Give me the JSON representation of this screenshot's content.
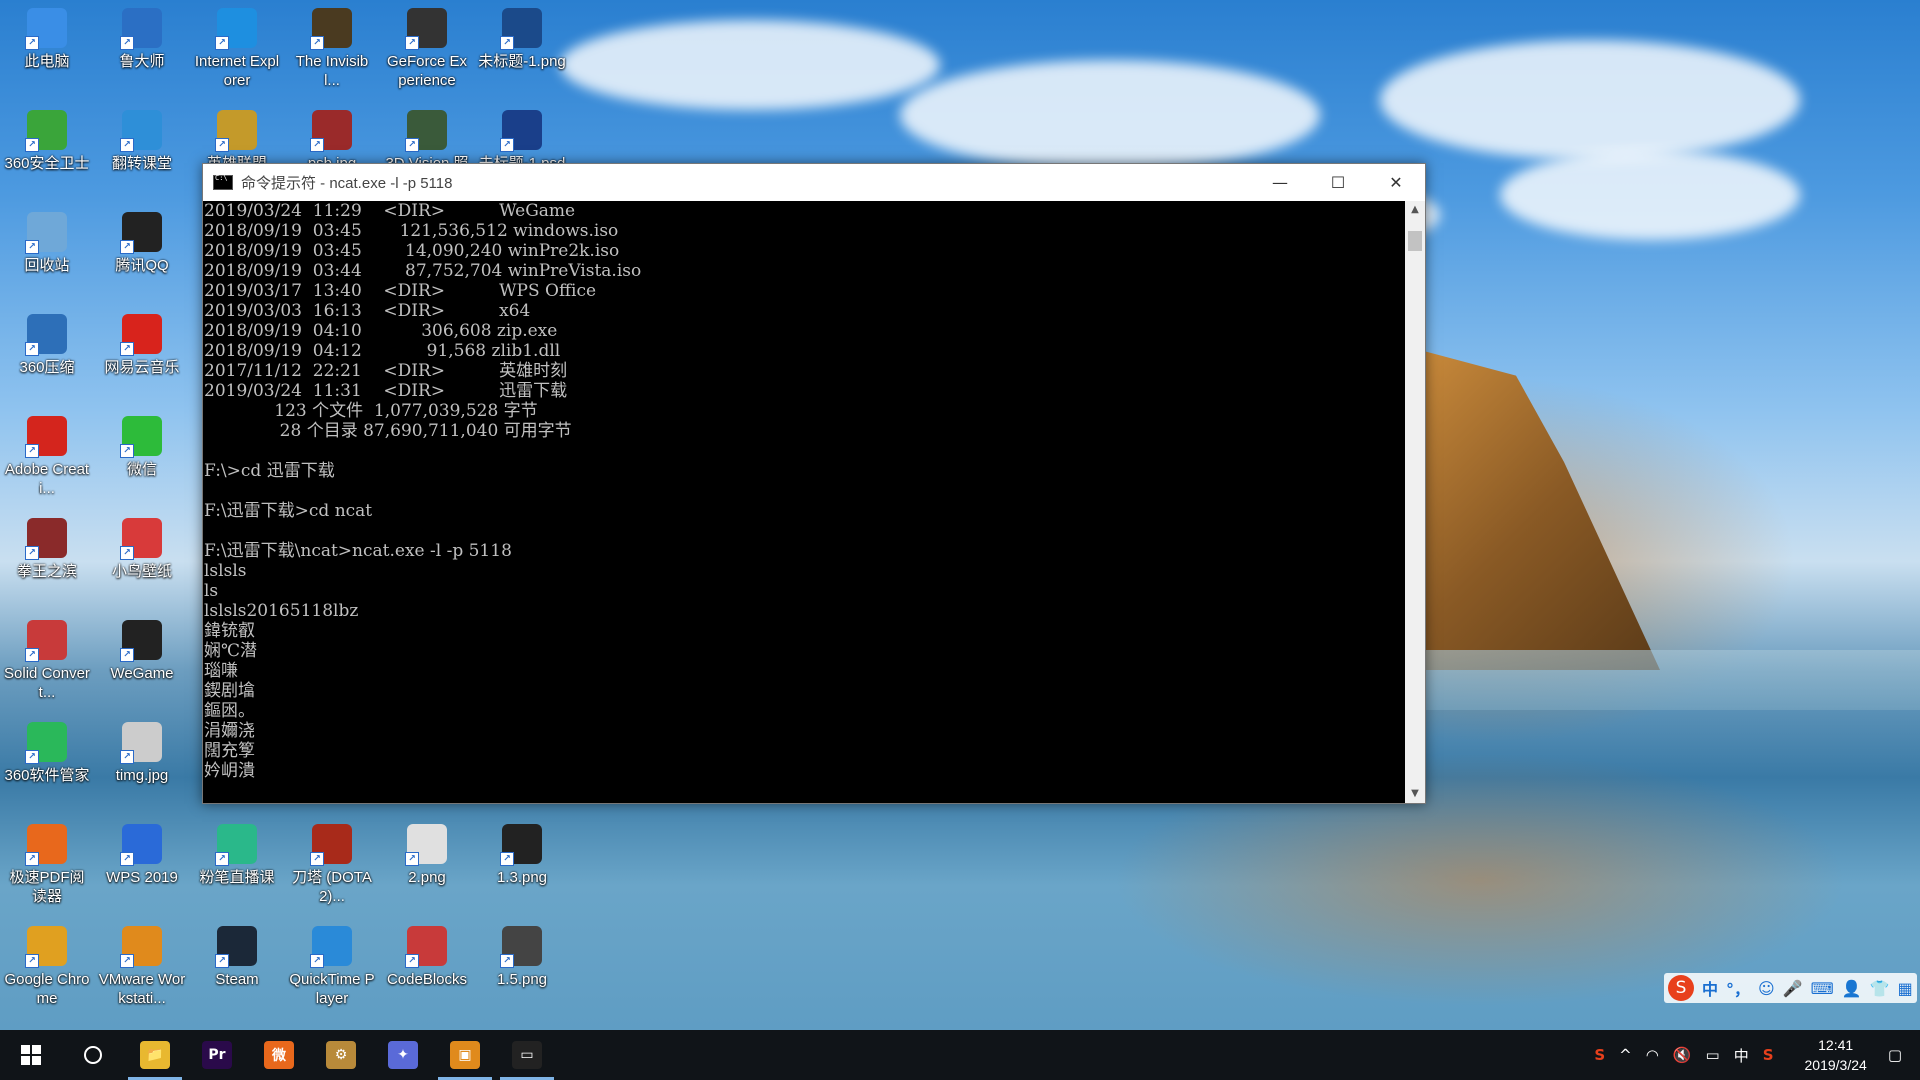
{
  "desktop": {
    "icons": [
      {
        "label": "此电脑",
        "icon": "computer-icon",
        "color": "#3a8ee6"
      },
      {
        "label": "鲁大师",
        "icon": "ludashi-icon",
        "color": "#2b6fc4"
      },
      {
        "label": "Internet Explorer",
        "icon": "ie-icon",
        "color": "#1e8fe0"
      },
      {
        "label": "The Invisibl...",
        "icon": "game-icon",
        "color": "#4a3a20"
      },
      {
        "label": "GeForce Experience",
        "icon": "geforce-icon",
        "color": "#333333"
      },
      {
        "label": "未标题-1.png",
        "icon": "image-file-icon",
        "color": "#1b4a8a"
      },
      {
        "label": "360安全卫士",
        "icon": "360-security-icon",
        "color": "#3aa53a"
      },
      {
        "label": "翻转课堂",
        "icon": "flip-class-icon",
        "color": "#2e8fd8"
      },
      {
        "label": "英雄联盟",
        "icon": "lol-icon",
        "color": "#c49a2a"
      },
      {
        "label": "psb.jpg",
        "icon": "image-file-icon",
        "color": "#9a2a2a"
      },
      {
        "label": "3D Vision 照片查看器",
        "icon": "3d-vision-icon",
        "color": "#3a5a3a"
      },
      {
        "label": "未标题-1.psd",
        "icon": "photoshop-icon",
        "color": "#1a3f8a"
      },
      {
        "label": "回收站",
        "icon": "recycle-bin-icon",
        "color": "#6fa8d8"
      },
      {
        "label": "腾讯QQ",
        "icon": "qq-icon",
        "color": "#222222"
      },
      {
        "label": "360压缩",
        "icon": "360-zip-icon",
        "color": "#2d6fb8"
      },
      {
        "label": "网易云音乐",
        "icon": "netease-music-icon",
        "color": "#d8231c"
      },
      {
        "label": "Adobe Creati...",
        "icon": "adobe-cc-icon",
        "color": "#d4251d"
      },
      {
        "label": "微信",
        "icon": "wechat-icon",
        "color": "#2dbb3a"
      },
      {
        "label": "拳王之滨",
        "icon": "game-icon",
        "color": "#8a2a2a"
      },
      {
        "label": "小鸟壁纸",
        "icon": "bird-wallpaper-icon",
        "color": "#d83a3a"
      },
      {
        "label": "Solid Convert...",
        "icon": "solid-converter-icon",
        "color": "#c83a3a"
      },
      {
        "label": "WeGame",
        "icon": "wegame-icon",
        "color": "#222222"
      },
      {
        "label": "360软件管家",
        "icon": "360-software-icon",
        "color": "#2ab85a"
      },
      {
        "label": "timg.jpg",
        "icon": "image-file-icon",
        "color": "#cccccc"
      },
      {
        "label": "极速PDF阅读器",
        "icon": "pdf-reader-icon",
        "color": "#e8681c"
      },
      {
        "label": "WPS 2019",
        "icon": "wps-icon",
        "color": "#2a6ad8"
      },
      {
        "label": "粉笔直播课",
        "icon": "fenbi-icon",
        "color": "#2ab88a"
      },
      {
        "label": "刀塔 (DOTA2)...",
        "icon": "dota2-icon",
        "color": "#a82a1a"
      },
      {
        "label": "2.png",
        "icon": "image-file-icon",
        "color": "#e0e0e0"
      },
      {
        "label": "1.3.png",
        "icon": "image-file-icon",
        "color": "#222222"
      },
      {
        "label": "Google Chrome",
        "icon": "chrome-icon",
        "color": "#e0a020"
      },
      {
        "label": "VMware Workstati...",
        "icon": "vmware-icon",
        "color": "#e08a1c"
      },
      {
        "label": "Steam",
        "icon": "steam-icon",
        "color": "#1b2838"
      },
      {
        "label": "QuickTime Player",
        "icon": "quicktime-icon",
        "color": "#2a8ad8"
      },
      {
        "label": "CodeBlocks",
        "icon": "codeblocks-icon",
        "color": "#c83a3a"
      },
      {
        "label": "1.5.png",
        "icon": "image-file-icon",
        "color": "#444444"
      }
    ]
  },
  "cmd_window": {
    "title": "命令提示符 - ncat.exe  -l -p 5118",
    "minimize_glyph": "—",
    "maximize_glyph": "☐",
    "close_glyph": "✕",
    "lines": [
      "2019/03/24  11:29    <DIR>          WeGame",
      "2018/09/19  03:45       121,536,512 windows.iso",
      "2018/09/19  03:45        14,090,240 winPre2k.iso",
      "2018/09/19  03:44        87,752,704 winPreVista.iso",
      "2019/03/17  13:40    <DIR>          WPS Office",
      "2019/03/03  16:13    <DIR>          x64",
      "2018/09/19  04:10           306,608 zip.exe",
      "2018/09/19  04:12            91,568 zlib1.dll",
      "2017/11/12  22:21    <DIR>          英雄时刻",
      "2019/03/24  11:31    <DIR>          迅雷下载",
      "             123 个文件  1,077,039,528 字节",
      "              28 个目录 87,690,711,040 可用字节",
      "",
      "F:\\>cd 迅雷下载",
      "",
      "F:\\迅雷下载>cd ncat",
      "",
      "F:\\迅雷下载\\ncat>ncat.exe -l -p 5118",
      "lslsls",
      "ls",
      "lslsls20165118lbz",
      "鍏铳叡",
      "娴℃潜",
      "瑙嗛",
      "鍥剧墖",
      "鏂囦。",
      "涓嬭浇",
      "闊充箰",
      "妗岄潰"
    ]
  },
  "ime_bar": {
    "logo": "S",
    "items": [
      "中",
      "°，",
      "☺",
      "🎤",
      "⌨",
      "👤",
      "👕",
      "▦"
    ]
  },
  "taskbar": {
    "apps": [
      {
        "name": "file-explorer",
        "glyph": "📁",
        "color": "#e8b830",
        "active": true
      },
      {
        "name": "premiere",
        "glyph": "Pr",
        "color": "#2a0a4a",
        "active": false
      },
      {
        "name": "weibo",
        "glyph": "微",
        "color": "#e8681c",
        "active": false
      },
      {
        "name": "app-gear",
        "glyph": "⚙",
        "color": "#b88a3a",
        "active": false
      },
      {
        "name": "app-kite",
        "glyph": "✦",
        "color": "#5a6ad8",
        "active": false
      },
      {
        "name": "vmware",
        "glyph": "▣",
        "color": "#e08a1c",
        "active": true
      },
      {
        "name": "cmd",
        "glyph": "▭",
        "color": "#222222",
        "active": true
      }
    ],
    "tray": {
      "sogou": "S",
      "chevron": "^",
      "network": "◠",
      "volume": "🔇",
      "battery": "▭",
      "lang": "中",
      "sogou2": "S",
      "time": "12:41",
      "date": "2019/3/24",
      "notification": "▢"
    }
  }
}
